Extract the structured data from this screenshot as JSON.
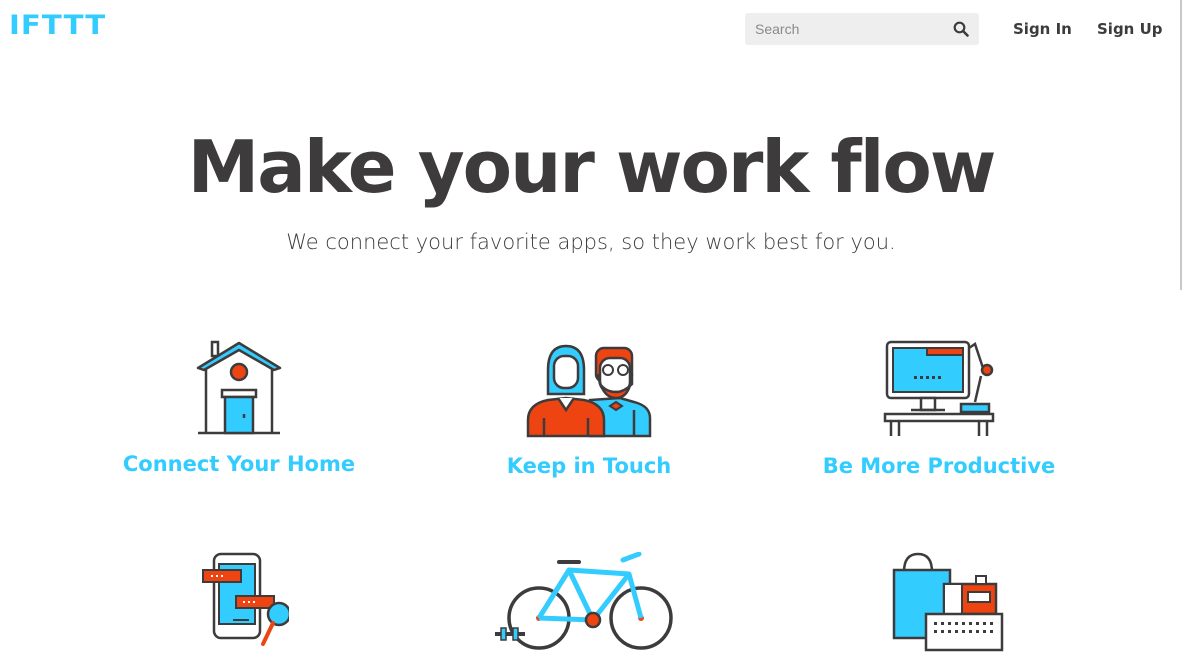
{
  "header": {
    "logo": "IFTTT",
    "search_placeholder": "Search",
    "sign_in": "Sign In",
    "sign_up": "Sign Up"
  },
  "hero": {
    "title": "Make your work flow",
    "subtitle": "We connect your favorite apps, so they work best for you."
  },
  "categories": [
    {
      "label": "Connect Your Home",
      "icon": "house-icon"
    },
    {
      "label": "Keep in Touch",
      "icon": "people-icon"
    },
    {
      "label": "Be More Productive",
      "icon": "desk-computer-icon"
    },
    {
      "label": "",
      "icon": "phone-chat-icon"
    },
    {
      "label": "",
      "icon": "bicycle-icon"
    },
    {
      "label": "",
      "icon": "shopping-register-icon"
    }
  ],
  "colors": {
    "accent": "#33ccff",
    "text": "#3e3b3c",
    "orange": "#ee4411",
    "search_bg": "#eeeeee"
  }
}
